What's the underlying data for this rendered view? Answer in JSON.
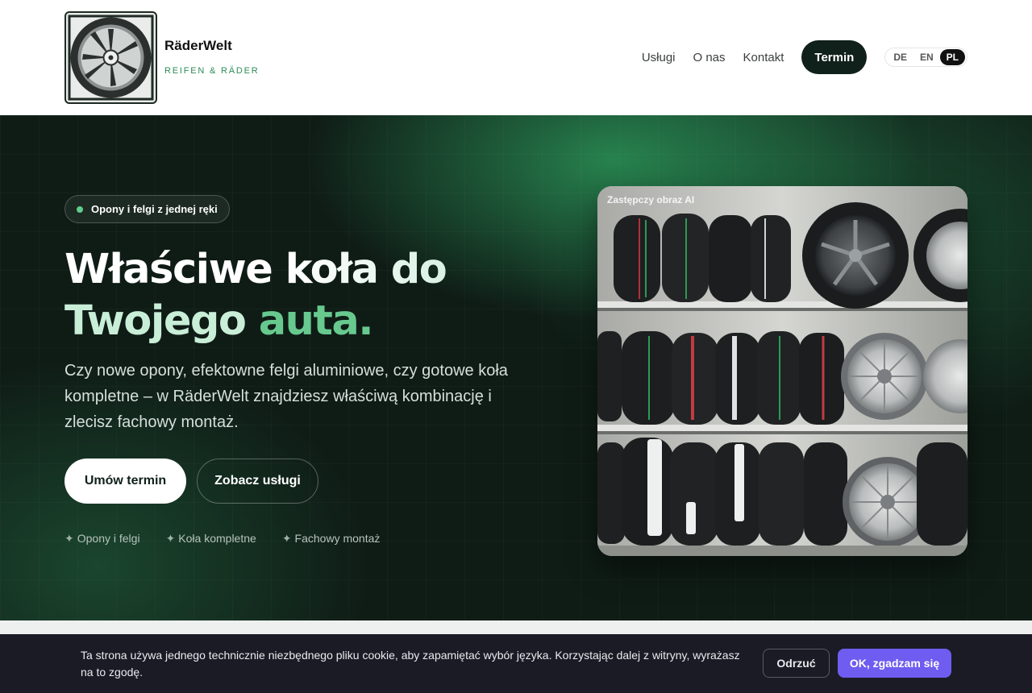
{
  "header": {
    "brand_name": "RäderWelt",
    "brand_tagline": "REIFEN & RÄDER",
    "logo_icon": "alloy-wheel-icon",
    "nav": {
      "services": "Usługi",
      "about": "O nas",
      "contact": "Kontakt"
    },
    "cta_label": "Termin",
    "languages": [
      "DE",
      "EN",
      "PL"
    ],
    "active_language": "PL"
  },
  "hero": {
    "badge": "Opony i felgi z jednej ręki",
    "title_line1": "Właściwe koła do",
    "title_line2_part1": "Twojego ",
    "title_line2_part2": "auta.",
    "lead": "Czy nowe opony, efektowne felgi aluminiowe, czy gotowe koła kompletne – w RäderWelt znajdziesz właściwą kombinację i zlecisz fachowy montaż.",
    "primary_button": "Umów termin",
    "secondary_button": "Zobacz usługi",
    "features": [
      "Opony i felgi",
      "Koła kompletne",
      "Fachowy montaż"
    ],
    "feature_icon": "✦",
    "image_caption": "Zastępczy obraz AI"
  },
  "cookie": {
    "text": "Ta strona używa jednego technicznie niezbędnego pliku cookie, aby zapamiętać wybór języka. Korzystając dalej z witryny, wyrażasz na to zgodę.",
    "decline": "Odrzuć",
    "accept": "OK, zgadzam się"
  },
  "colors": {
    "accent_green": "#67c98e",
    "hero_bg": "#0f1c16",
    "cookie_accept": "#6f5cf0",
    "cta_dark": "#10201a"
  }
}
